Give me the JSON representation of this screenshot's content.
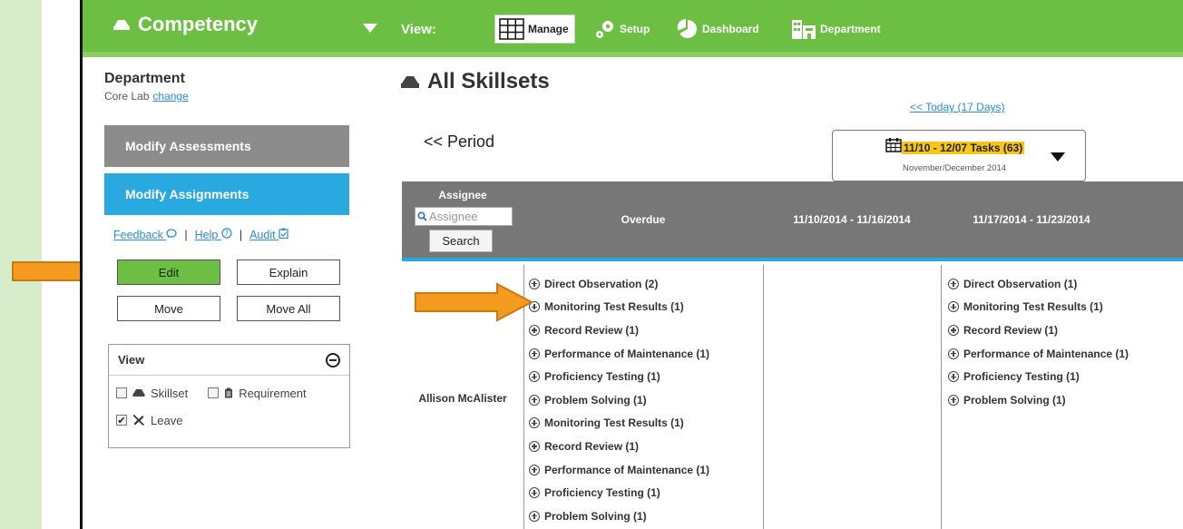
{
  "header": {
    "brand": "Competency",
    "view_label": "View:",
    "nav": [
      {
        "label": "Manage",
        "icon": "grid-icon"
      },
      {
        "label": "Setup",
        "icon": "gears-icon"
      },
      {
        "label": "Dashboard",
        "icon": "pie-chart-icon"
      },
      {
        "label": "Department",
        "icon": "building-icon"
      }
    ],
    "accent_color": "#6cbf42"
  },
  "sidebar": {
    "department_title": "Department",
    "department_name": "Core Lab",
    "change_link": "change",
    "modify_assessments": "Modify Assessments",
    "modify_assignments": "Modify Assignments",
    "links": {
      "feedback": "Feedback",
      "help": "Help",
      "audit": "Audit",
      "separator": "|"
    },
    "buttons": {
      "edit": "Edit",
      "explain": "Explain",
      "move": "Move",
      "move_all": "Move All"
    },
    "view_panel": {
      "title": "View",
      "options": [
        {
          "label": "Skillset",
          "checked": false,
          "icon": "skillset-icon"
        },
        {
          "label": "Requirement",
          "checked": false,
          "icon": "clipboard-icon"
        },
        {
          "label": "Leave",
          "checked": true,
          "icon": "airplane-icon"
        }
      ]
    }
  },
  "main": {
    "title": "All Skillsets",
    "today_link": "<< Today (17 Days)",
    "period_link": "<< Period",
    "period": {
      "range": "11/10 - 12/07 Tasks (63)",
      "subtitle": "November/December 2014"
    },
    "grid": {
      "assignee_header": "Assignee",
      "assignee_placeholder": "Assignee",
      "search_button": "Search",
      "columns": [
        "Overdue",
        "11/10/2014 - 11/16/2014",
        "11/17/2014 - 11/23/2014"
      ],
      "rows": [
        {
          "assignee": "Allison McAlister",
          "overdue": [
            "Direct Observation (2)",
            "Monitoring Test Results (1)",
            "Record Review (1)",
            "Performance of Maintenance (1)",
            "Proficiency Testing (1)",
            "Problem Solving (1)",
            "Monitoring Test Results (1)",
            "Record Review (1)",
            "Performance of Maintenance (1)",
            "Proficiency Testing (1)",
            "Problem Solving (1)"
          ],
          "week1": [],
          "week2": [
            "Direct Observation (1)",
            "Monitoring Test Results (1)",
            "Record Review (1)",
            "Performance of Maintenance (1)",
            "Proficiency Testing (1)",
            "Problem Solving (1)"
          ]
        }
      ]
    }
  }
}
